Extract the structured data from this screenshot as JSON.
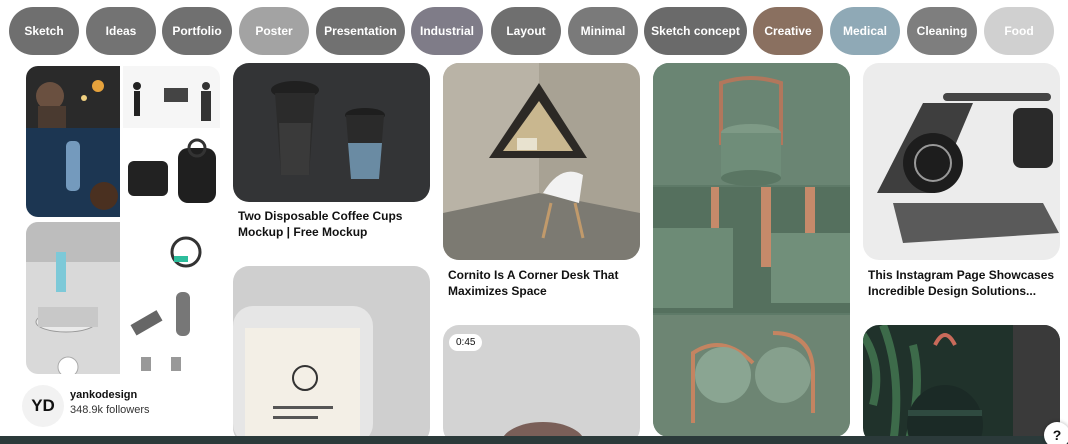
{
  "chips": [
    {
      "label": "Sketch",
      "color": "#6f6f6f"
    },
    {
      "label": "Ideas",
      "color": "#737373"
    },
    {
      "label": "Portfolio",
      "color": "#707070"
    },
    {
      "label": "Poster",
      "color": "#a3a3a3"
    },
    {
      "label": "Presentation",
      "color": "#717171"
    },
    {
      "label": "Industrial",
      "color": "#7f7c88"
    },
    {
      "label": "Layout",
      "color": "#6f6f6f"
    },
    {
      "label": "Minimal",
      "color": "#7a7a7a"
    },
    {
      "label": "Sketch concept",
      "color": "#6a6a6a"
    },
    {
      "label": "Creative",
      "color": "#8a7060"
    },
    {
      "label": "Medical",
      "color": "#8fa9b6"
    },
    {
      "label": "Cleaning",
      "color": "#7e7e7e"
    },
    {
      "label": "Food",
      "color": "#d0d0d0"
    }
  ],
  "pins": {
    "coffee": {
      "caption": "Two Disposable Coffee Cups Mockup | Free Mockup"
    },
    "corner": {
      "caption": "Cornito Is A Corner Desk That Maximizes Space"
    },
    "stand": {
      "caption": "This Instagram Page Showcases Incredible Design Solutions..."
    },
    "video": {
      "duration": "0:45"
    }
  },
  "board": {
    "avatar_text": "YD",
    "name": "yankodesign",
    "followers": "348.9k followers"
  },
  "help_icon": "?"
}
